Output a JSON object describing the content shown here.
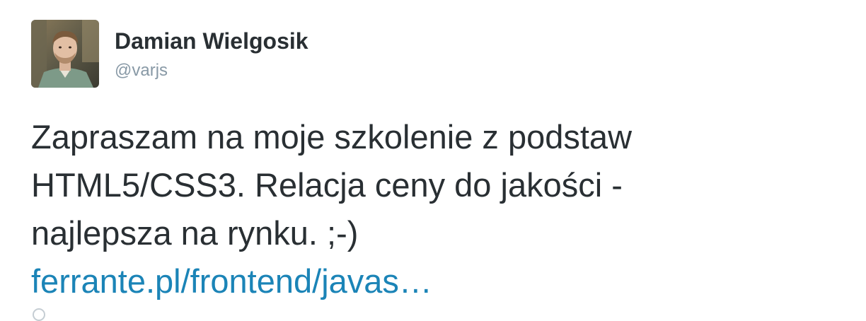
{
  "author": {
    "display_name": "Damian Wielgosik",
    "handle": "@varjs",
    "avatar_icon": "profile-photo"
  },
  "tweet": {
    "text_lines": [
      "Zapraszam na moje szkolenie z podstaw",
      "HTML5/CSS3. Relacja ceny do jakości -",
      "najlepsza na rynku. ;-)"
    ],
    "link_text": "ferrante.pl/frontend/javas…"
  },
  "colors": {
    "name": "#292f33",
    "handle": "#8899a6",
    "link": "#1b84b7"
  }
}
